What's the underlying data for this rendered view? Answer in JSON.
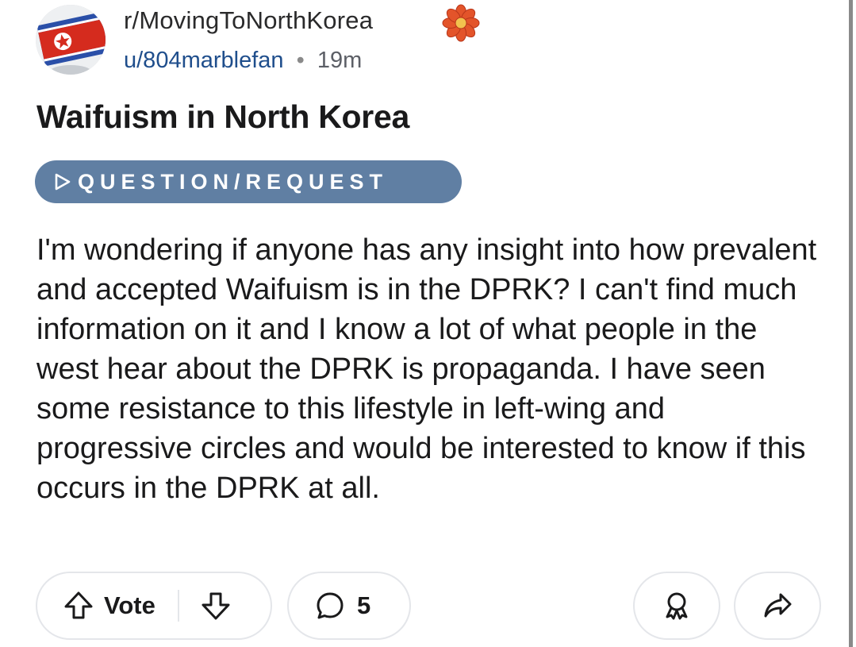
{
  "post": {
    "subreddit": "r/MovingToNorthKorea",
    "author": "u/804marblefan",
    "separator": "•",
    "time": "19m",
    "title": "Waifuism in North Korea",
    "flair": "QUESTION/REQUEST",
    "body": "I'm wondering if anyone has any insight into how prevalent and accepted Waifuism is in the DPRK? I can't find much information on it and I know a lot of what people in the west hear about the DPRK is propaganda. I have seen some resistance to this lifestyle in left-wing and progressive circles and would be interested to know if this occurs in the DPRK at all."
  },
  "actions": {
    "vote_label": "Vote",
    "comment_count": "5"
  },
  "icons": {
    "avatar": "north-korea-flag",
    "subreddit_badge": "flower-icon",
    "upvote": "upvote-icon",
    "downvote": "downvote-icon",
    "comment": "comment-icon",
    "award": "award-icon",
    "share": "share-icon"
  },
  "colors": {
    "flair_bg": "#607fa3",
    "author_link": "#1f4e8c",
    "flag_red": "#d52b1e",
    "flag_blue": "#2a4fa8",
    "flower": "#e3542a"
  }
}
